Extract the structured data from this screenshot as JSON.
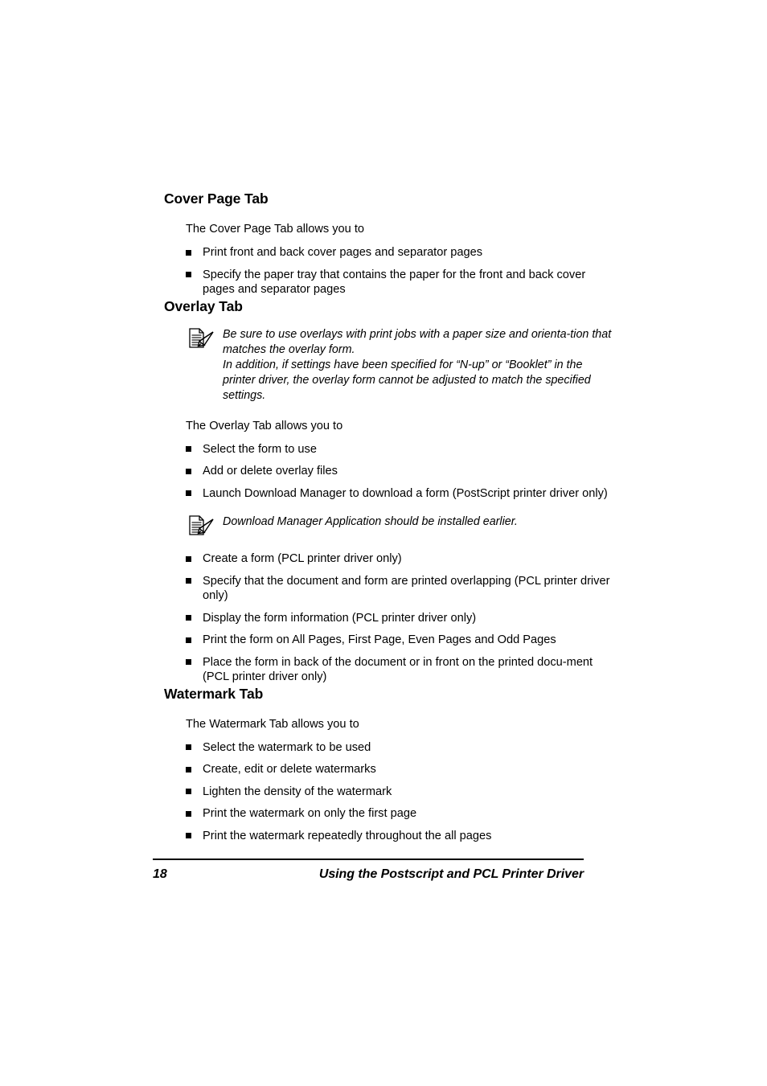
{
  "document": {
    "page_background": "#ffffff",
    "text_color": "#000000"
  },
  "sections": [
    {
      "heading": "Cover Page Tab",
      "intro": "The Cover Page Tab allows you to",
      "bullets": [
        "Print front and back cover pages and separator pages",
        "Specify the paper tray that contains the paper for the front and back cover pages and separator pages"
      ]
    },
    {
      "heading": "Overlay Tab",
      "note_top": {
        "icon": "note-pen-icon",
        "lines": [
          "Be sure to use overlays with print jobs with a paper size and orienta-tion that matches the overlay form.",
          "In addition, if settings have been specified for “N-up” or “Booklet” in the printer driver, the overlay form cannot be adjusted to match the specified settings."
        ]
      },
      "intro": "The Overlay Tab allows you to",
      "bullets_before_note": [
        "Select the form to use",
        "Add or delete overlay files",
        "Launch Download Manager to download a form (PostScript printer driver only)"
      ],
      "note_inline": {
        "icon": "note-pen-icon",
        "text": "Download Manager Application should be installed earlier."
      },
      "bullets_after_note": [
        "Create a form (PCL printer driver only)",
        "Specify that the document and form are printed overlapping (PCL printer driver only)",
        "Display the form information (PCL printer driver only)",
        "Print the form on All Pages, First Page, Even Pages and Odd Pages",
        "Place the form in back of the document or in front on the printed docu-ment (PCL printer driver only)"
      ]
    },
    {
      "heading": "Watermark Tab",
      "intro": "The Watermark Tab allows you to",
      "bullets": [
        "Select the watermark to be used",
        "Create, edit or delete watermarks",
        "Lighten the density of the watermark",
        "Print the watermark on only the first page",
        "Print the watermark repeatedly throughout the all pages"
      ]
    }
  ],
  "footer": {
    "page_number": "18",
    "title": "Using the Postscript and PCL Printer Driver"
  }
}
